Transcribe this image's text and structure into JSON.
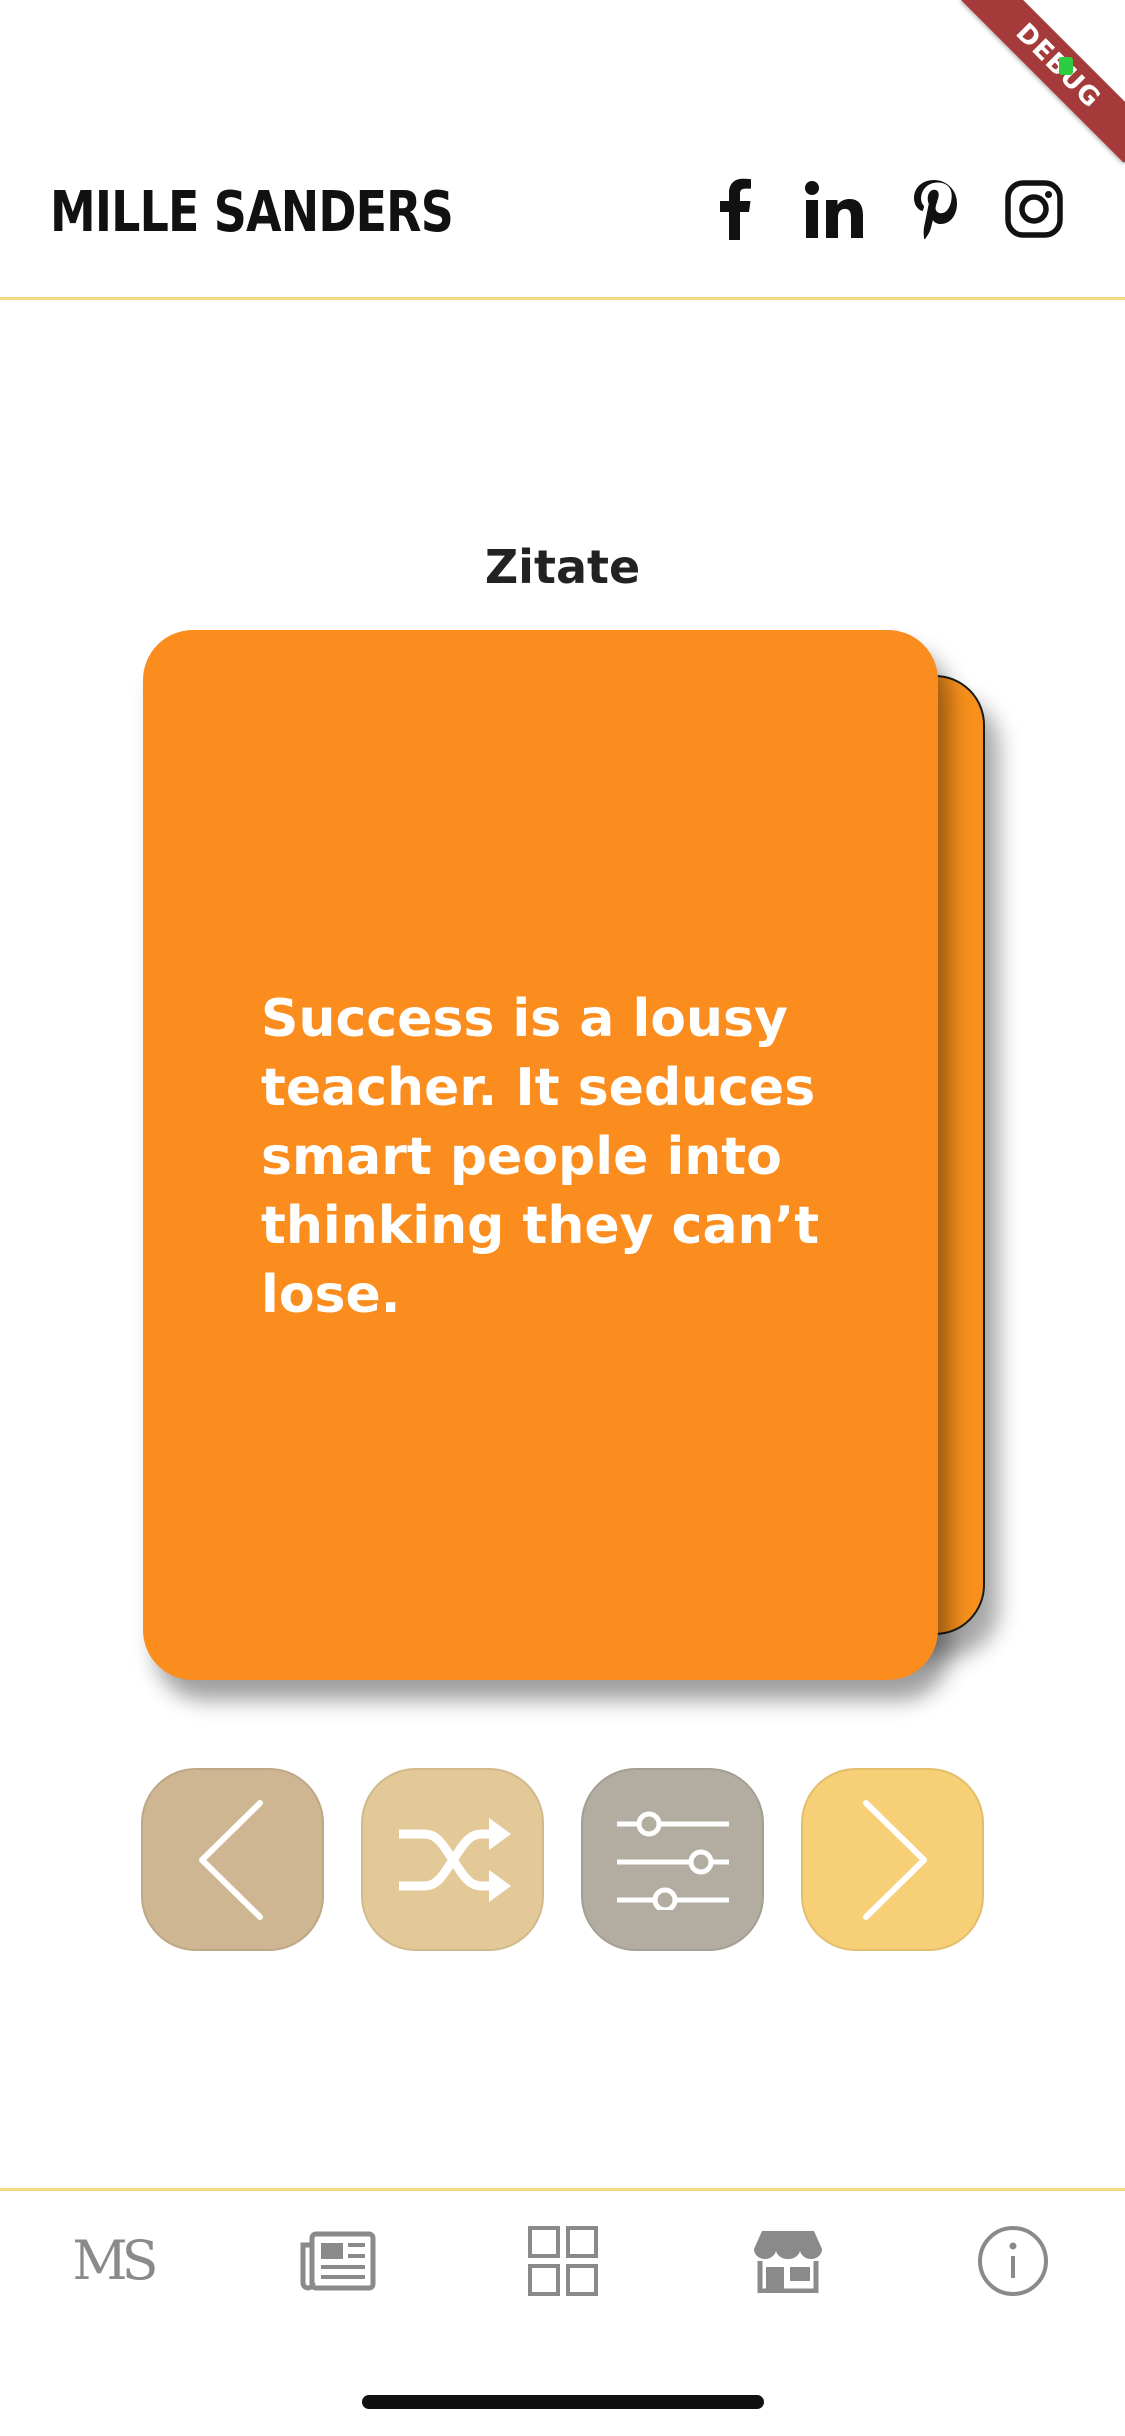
{
  "debug": {
    "label": "DEBUG"
  },
  "header": {
    "brand": "MILLE SANDERS",
    "social": [
      {
        "icon": "facebook-icon"
      },
      {
        "icon": "linkedin-icon"
      },
      {
        "icon": "pinterest-icon"
      },
      {
        "icon": "instagram-icon"
      }
    ]
  },
  "page": {
    "category_title": "Zitate"
  },
  "card": {
    "quote": "Success is a lousy teacher. It seduces smart people into thinking they can’t lose.",
    "color": "#fb8c1e"
  },
  "controls": [
    {
      "icon": "chevron-left-icon",
      "color": "#ceb693"
    },
    {
      "icon": "shuffle-icon",
      "color": "#e4c998"
    },
    {
      "icon": "sliders-icon",
      "color": "#b2ada0"
    },
    {
      "icon": "chevron-right-icon",
      "color": "#f7cf76"
    }
  ],
  "bottom_nav": {
    "logo_text": "MS",
    "items": [
      {
        "icon": "ms-logo-icon"
      },
      {
        "icon": "newspaper-icon"
      },
      {
        "icon": "grid-icon"
      },
      {
        "icon": "store-icon"
      },
      {
        "icon": "info-icon"
      }
    ]
  },
  "colors": {
    "accent_line": "#f3d98a",
    "nav_icon": "#8a8a8a"
  }
}
